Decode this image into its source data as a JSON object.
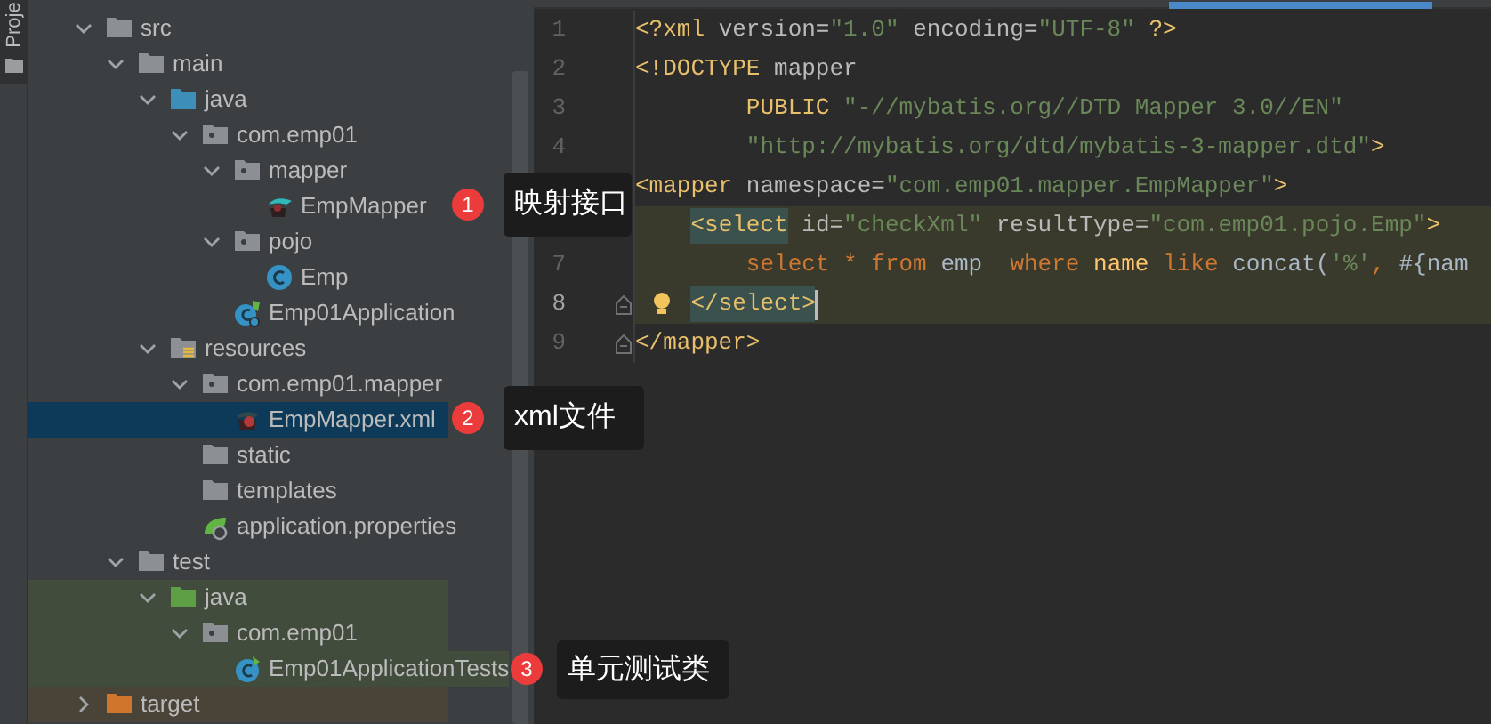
{
  "tool_strip": {
    "label": "Proje"
  },
  "project_tree": [
    {
      "label": "src",
      "kind": "folder",
      "expanded": true,
      "selected": false,
      "tinted": false,
      "children": [
        {
          "label": "main",
          "kind": "folder",
          "expanded": true,
          "selected": false,
          "tinted": false,
          "children": [
            {
              "label": "java",
              "kind": "source_root",
              "expanded": true,
              "selected": false,
              "tinted": false,
              "children": [
                {
                  "label": "com.emp01",
                  "kind": "package",
                  "expanded": true,
                  "selected": false,
                  "tinted": false,
                  "children": [
                    {
                      "label": "mapper",
                      "kind": "package",
                      "expanded": true,
                      "selected": false,
                      "tinted": false,
                      "children": [
                        {
                          "label": "EmpMapper",
                          "kind": "mapper_interface",
                          "selected": false,
                          "tinted": false
                        }
                      ]
                    },
                    {
                      "label": "pojo",
                      "kind": "package",
                      "expanded": true,
                      "selected": false,
                      "tinted": false,
                      "children": [
                        {
                          "label": "Emp",
                          "kind": "class",
                          "selected": false,
                          "tinted": false
                        }
                      ]
                    },
                    {
                      "label": "Emp01Application",
                      "kind": "spring_class",
                      "selected": false,
                      "tinted": false
                    }
                  ]
                }
              ]
            },
            {
              "label": "resources",
              "kind": "resources_root",
              "expanded": true,
              "selected": false,
              "tinted": false,
              "children": [
                {
                  "label": "com.emp01.mapper",
                  "kind": "package",
                  "expanded": true,
                  "selected": false,
                  "tinted": false,
                  "children": [
                    {
                      "label": "EmpMapper.xml",
                      "kind": "xml_mapper",
                      "selected": true,
                      "tinted": false
                    }
                  ]
                },
                {
                  "label": "static",
                  "kind": "folder",
                  "selected": false,
                  "tinted": false
                },
                {
                  "label": "templates",
                  "kind": "folder",
                  "selected": false,
                  "tinted": false
                },
                {
                  "label": "application.properties",
                  "kind": "properties",
                  "selected": false,
                  "tinted": false
                }
              ]
            }
          ]
        },
        {
          "label": "test",
          "kind": "folder",
          "expanded": true,
          "selected": false,
          "tinted": false,
          "children": [
            {
              "label": "java",
              "kind": "test_root",
              "expanded": true,
              "selected": false,
              "tinted": true,
              "children": [
                {
                  "label": "com.emp01",
                  "kind": "package",
                  "expanded": true,
                  "selected": false,
                  "tinted": true,
                  "children": [
                    {
                      "label": "Emp01ApplicationTests",
                      "kind": "test_class",
                      "selected": false,
                      "tinted": true
                    }
                  ]
                }
              ]
            }
          ]
        }
      ]
    },
    {
      "label": "target",
      "kind": "excluded",
      "expanded": false,
      "selected": false,
      "tinted": true
    }
  ],
  "editor": {
    "lines": [
      {
        "number": "1",
        "current": false,
        "highlighted": false,
        "fold_start": false,
        "fold_end": false,
        "tokens": [
          {
            "kind": "tag",
            "text": "<?xml"
          },
          {
            "kind": "attr",
            "text": " version="
          },
          {
            "kind": "val",
            "text": "\"1.0\""
          },
          {
            "kind": "attr",
            "text": " encoding="
          },
          {
            "kind": "val",
            "text": "\"UTF-8\""
          },
          {
            "kind": "tag",
            "text": " ?>"
          }
        ]
      },
      {
        "number": "2",
        "current": false,
        "highlighted": false,
        "fold_start": false,
        "fold_end": false,
        "tokens": [
          {
            "kind": "tag",
            "text": "<!DOCTYPE"
          },
          {
            "kind": "attr",
            "text": " mapper"
          }
        ]
      },
      {
        "number": "3",
        "current": false,
        "highlighted": false,
        "fold_start": false,
        "fold_end": false,
        "tokens": [
          {
            "kind": "tag",
            "text": "        PUBLIC"
          },
          {
            "kind": "val",
            "text": " \"-//mybatis.org//DTD Mapper 3.0//EN\""
          }
        ]
      },
      {
        "number": "4",
        "current": false,
        "highlighted": false,
        "fold_start": false,
        "fold_end": false,
        "tokens": [
          {
            "kind": "val",
            "text": "        \"http://mybatis.org/dtd/mybatis-3-mapper.dtd\""
          },
          {
            "kind": "tag",
            "text": ">"
          }
        ]
      },
      {
        "current": false,
        "highlighted": false,
        "tokens": [
          {
            "kind": "tag",
            "text": "<mapper"
          },
          {
            "kind": "attr",
            "text": " namespace="
          },
          {
            "kind": "val",
            "text": "\"com.emp01.mapper.EmpMapper\""
          },
          {
            "kind": "tag",
            "text": ">"
          }
        ]
      },
      {
        "current": false,
        "highlighted": true,
        "tokens": [
          {
            "kind": "tag_match",
            "text": "    <select"
          },
          {
            "kind": "attr",
            "text": " id="
          },
          {
            "kind": "val",
            "text": "\"checkXml\""
          },
          {
            "kind": "attr",
            "text": " resultType="
          },
          {
            "kind": "val",
            "text": "\"com.emp01.pojo.Emp\""
          },
          {
            "kind": "tag",
            "text": ">"
          }
        ]
      },
      {
        "number": "7",
        "current": false,
        "highlighted": true,
        "fold_start": false,
        "fold_end": false,
        "tokens": [
          {
            "kind": "kw",
            "text": "        select"
          },
          {
            "kind": "kw",
            "text": " * "
          },
          {
            "kind": "kw",
            "text": "from"
          },
          {
            "kind": "text",
            "text": " emp  "
          },
          {
            "kind": "kw",
            "text": "where"
          },
          {
            "kind": "ident",
            "text": " name"
          },
          {
            "kind": "kw",
            "text": " like"
          },
          {
            "kind": "text",
            "text": " concat("
          },
          {
            "kind": "val",
            "text": "'%'"
          },
          {
            "kind": "kw",
            "text": ","
          },
          {
            "kind": "text",
            "text": " #{nam"
          }
        ]
      },
      {
        "number": "8",
        "current": true,
        "highlighted": true,
        "fold_start": false,
        "fold_end": true,
        "tokens": [
          {
            "kind": "tag_match",
            "text": "    </select>"
          }
        ]
      },
      {
        "number": "9",
        "current": false,
        "highlighted": false,
        "fold_start": false,
        "fold_end": true,
        "tokens": [
          {
            "kind": "tag",
            "text": "</mapper>"
          }
        ]
      }
    ]
  },
  "annotations": [
    {
      "number": "1",
      "label": "映射接口"
    },
    {
      "number": "2",
      "label": "xml文件"
    },
    {
      "number": "3",
      "label": "单元测试类"
    }
  ]
}
